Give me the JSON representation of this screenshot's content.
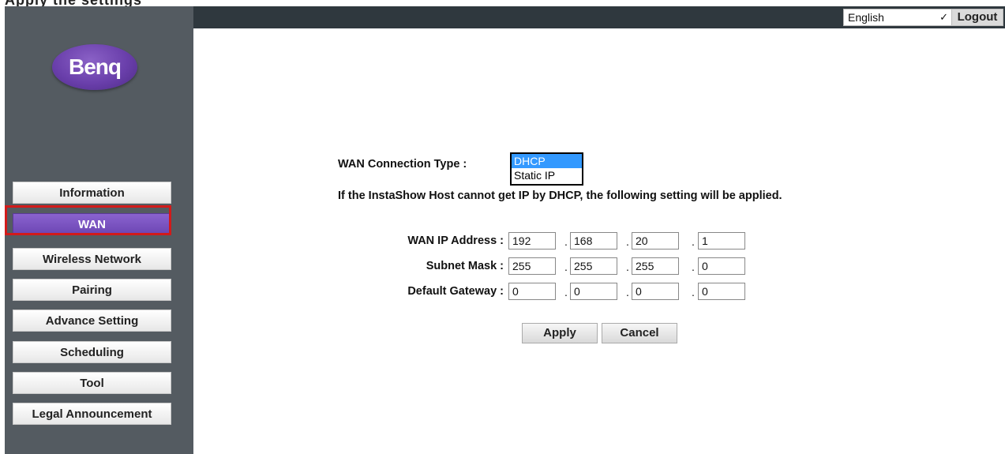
{
  "top_fragment": "Apply the settings",
  "brand": {
    "logo_text": "Benq"
  },
  "sidebar": {
    "items": [
      {
        "label": "Information"
      },
      {
        "label": "WAN"
      },
      {
        "label": "Wireless Network"
      },
      {
        "label": "Pairing"
      },
      {
        "label": "Advance Setting"
      },
      {
        "label": "Scheduling"
      },
      {
        "label": "Tool"
      },
      {
        "label": "Legal Announcement"
      }
    ],
    "active_index": 1
  },
  "topbar": {
    "language": "English",
    "logout_label": "Logout"
  },
  "wan": {
    "connection_type_label": "WAN  Connection Type :",
    "connection_options": [
      "DHCP",
      "Static IP"
    ],
    "selected_option": "DHCP",
    "note": "If the InstaShow Host cannot get IP by DHCP, the following setting will be applied.",
    "fields": [
      {
        "label": "WAN IP Address :",
        "octets": [
          "192",
          "168",
          "20",
          "1"
        ]
      },
      {
        "label": "Subnet Mask :",
        "octets": [
          "255",
          "255",
          "255",
          "0"
        ]
      },
      {
        "label": "Default Gateway :",
        "octets": [
          "0",
          "0",
          "0",
          "0"
        ]
      }
    ],
    "apply_label": "Apply",
    "cancel_label": "Cancel"
  },
  "colors": {
    "accent": "#6c45b3",
    "sidebar": "#545b61",
    "topbar": "#2f383e",
    "highlight": "#d21a1a"
  }
}
